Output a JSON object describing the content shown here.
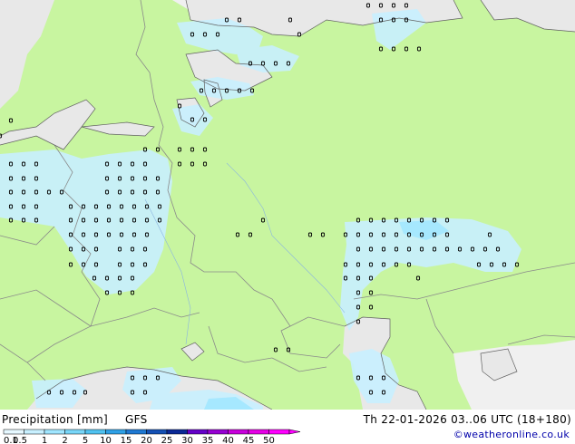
{
  "colors": {
    "land_forecast": "#c8f5a0",
    "no_forecast": "#f0f0f0",
    "water": "#e8e8e8",
    "precip_light": "#c8f0ff",
    "precip_medium": "#a0e6ff",
    "border": "#8a8a8a",
    "coast": "#606060"
  },
  "footer": {
    "title": "Precipitation [mm]",
    "model": "GFS",
    "run": "Th 22-01-2026 03..06 UTC (18+180)",
    "credit": "©weatheronline.co.uk"
  },
  "legend": {
    "ticks": [
      "0.1",
      "0.5",
      "1",
      "2",
      "5",
      "10",
      "15",
      "20",
      "25",
      "30",
      "35",
      "40",
      "45",
      "50"
    ],
    "colors": [
      "#e6f8ff",
      "#c8f0ff",
      "#a0e6ff",
      "#78d6f8",
      "#50c2f0",
      "#2ea0e6",
      "#1e78d2",
      "#1450b4",
      "#0a2896",
      "#6400c8",
      "#9600d2",
      "#c800dc",
      "#e600e6",
      "#ff00ff"
    ]
  }
}
